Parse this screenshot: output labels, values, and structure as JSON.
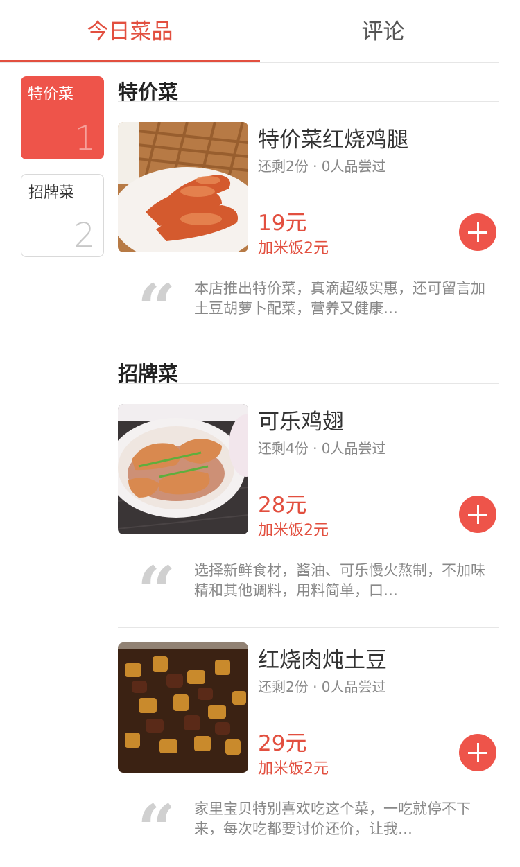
{
  "tabs": [
    {
      "label": "今日菜品",
      "active": true
    },
    {
      "label": "评论",
      "active": false
    }
  ],
  "categories": [
    {
      "label": "特价菜",
      "count": "1",
      "active": true
    },
    {
      "label": "招牌菜",
      "count": "2",
      "active": false
    }
  ],
  "sections": [
    {
      "title": "特价菜",
      "dishes": [
        {
          "name": "特价菜红烧鸡腿",
          "meta": "还剩2份 · 0人品尝过",
          "price": "19元",
          "rice": "加米饭2元",
          "description": "本店推出特价菜，真滴超级实惠，还可留言加土豆胡萝卜配菜，营养又健康…"
        }
      ]
    },
    {
      "title": "招牌菜",
      "dishes": [
        {
          "name": "可乐鸡翅",
          "meta": "还剩4份 · 0人品尝过",
          "price": "28元",
          "rice": "加米饭2元",
          "description": "选择新鲜食材，酱油、可乐慢火熬制，不加味精和其他调料，用料简单，口…"
        },
        {
          "name": "红烧肉炖土豆",
          "meta": "还剩2份 · 0人品尝过",
          "price": "29元",
          "rice": "加米饭2元",
          "description": "家里宝贝特别喜欢吃这个菜，一吃就停不下来，每次吃都要讨价还价，让我…"
        }
      ]
    }
  ],
  "quote_symbol": "“",
  "colors": {
    "accent": "#e24f3f",
    "accent_bg": "#ee544a",
    "muted": "#888888"
  },
  "icons": {
    "add": "plus-icon",
    "quote": "quote-icon"
  }
}
